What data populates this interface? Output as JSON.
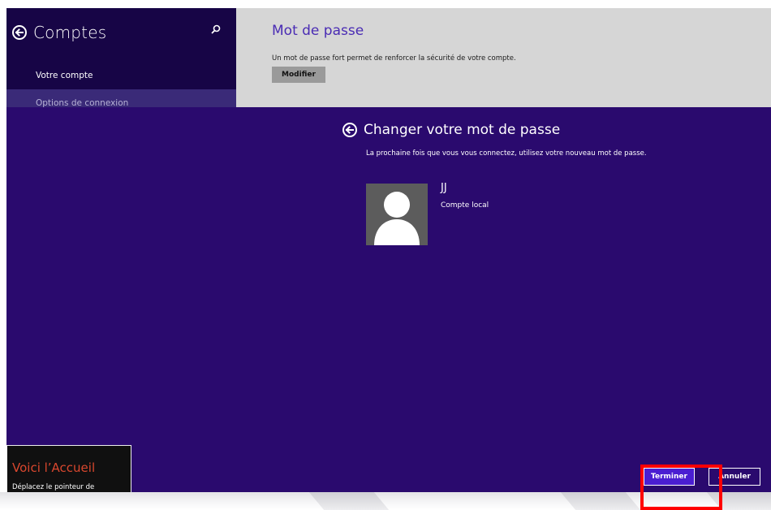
{
  "left_pane": {
    "title": "Comptes",
    "items": [
      {
        "label": "Votre compte"
      },
      {
        "label": "Options de connexion"
      }
    ]
  },
  "right_pane": {
    "section_title": "Mot de passe",
    "description": "Un mot de passe fort permet de renforcer la sécurité de votre compte.",
    "modify_label": "Modifier"
  },
  "dialog": {
    "title": "Changer votre mot de passe",
    "description": "La prochaine fois que vous vous connectez, utilisez votre nouveau mot de passe.",
    "user_name": "JJ",
    "account_type": "Compte local"
  },
  "start_tip": {
    "title": "Voici l’Accueil",
    "text": "Déplacez le pointeur de"
  },
  "buttons": {
    "finish_label": "Terminer",
    "cancel_label": "Annuler"
  },
  "colors": {
    "accent_purple": "#2a0a6e",
    "nav_dark": "#170546",
    "title_purple": "#4a2cb4",
    "highlight_red": "#ff0000",
    "tip_orange": "#d9472e"
  },
  "icons": {
    "back": "back-arrow-icon",
    "search": "search-icon",
    "avatar": "user-silhouette-icon"
  }
}
